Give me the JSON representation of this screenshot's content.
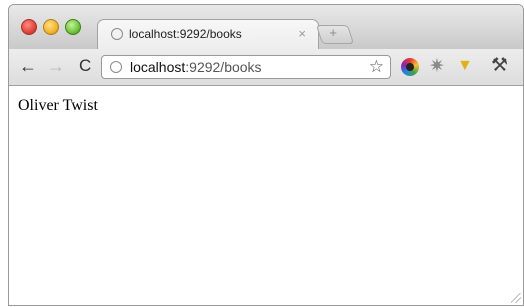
{
  "tab": {
    "title": "localhost:9292/books",
    "close_label": "×"
  },
  "toolbar": {
    "back_label": "←",
    "forward_label": "→",
    "reload_label": "C",
    "url_host": "localhost",
    "url_path": ":9292/books",
    "new_tab_label": "+"
  },
  "page": {
    "text": "Oliver Twist"
  },
  "icons": {
    "tab_favicon": "globe-icon",
    "address_icon": "globe-icon",
    "bookmark": "star-icon",
    "extension_1": "color-wheel-icon",
    "extension_2": "gear-icon",
    "extension_3": "yellow-extension-icon",
    "menu": "wrench-icon"
  }
}
